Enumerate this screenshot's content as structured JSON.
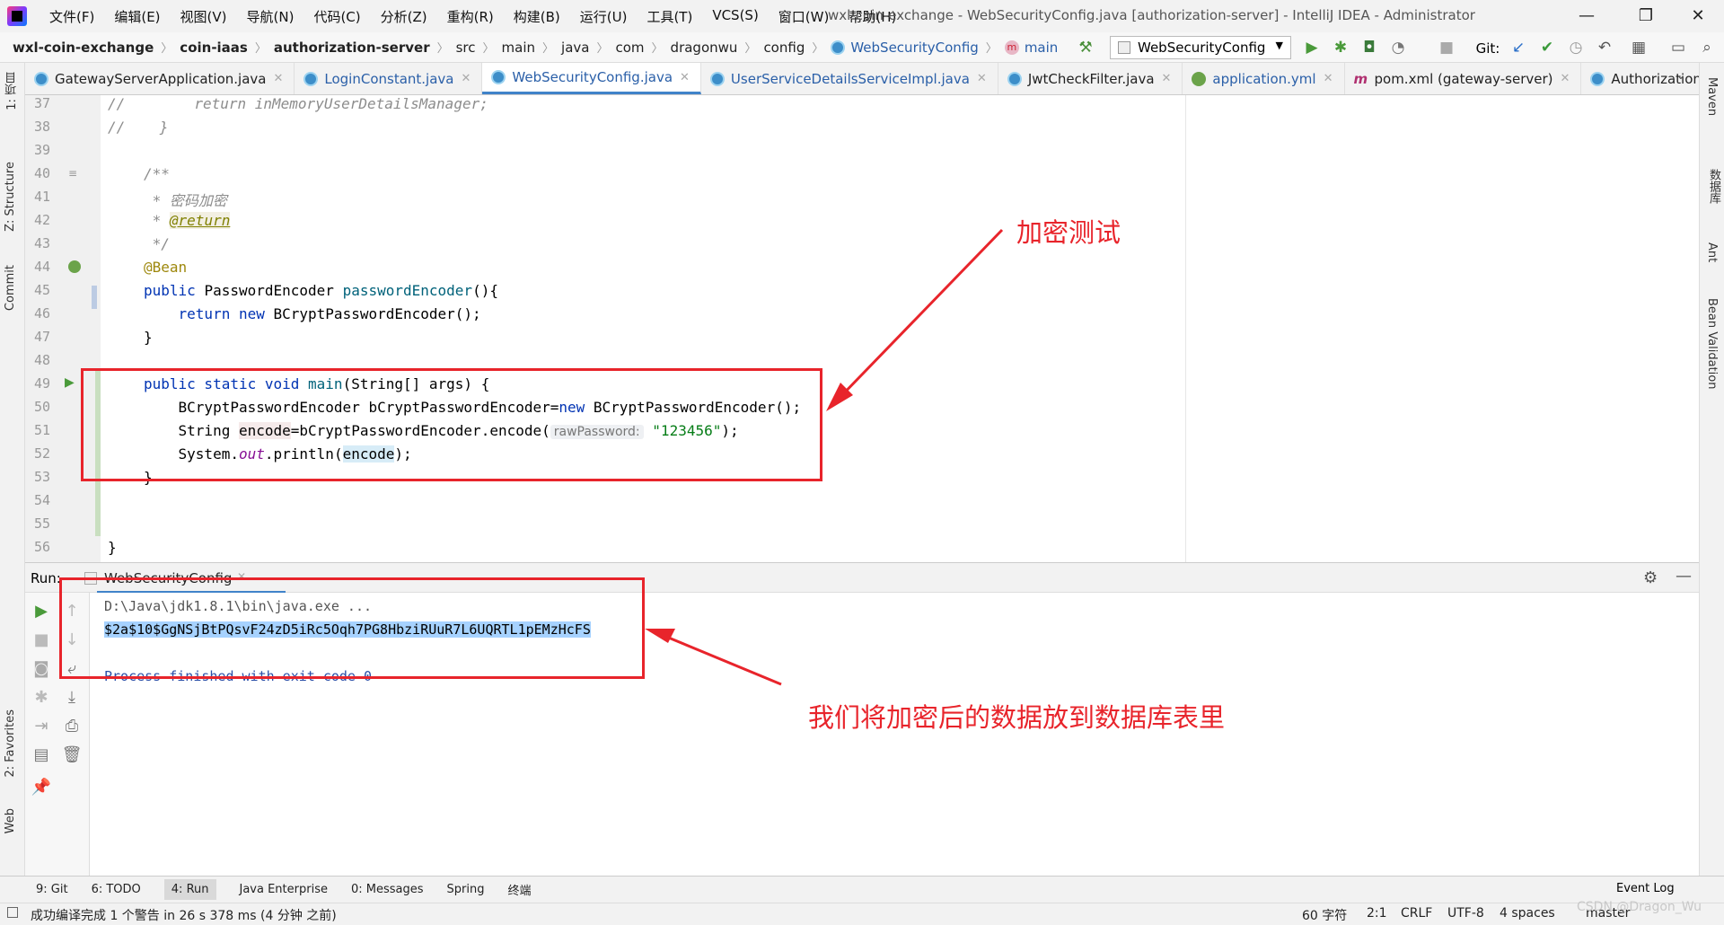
{
  "titlebar": {
    "menus": [
      "文件(F)",
      "编辑(E)",
      "视图(V)",
      "导航(N)",
      "代码(C)",
      "分析(Z)",
      "重构(R)",
      "构建(B)",
      "运行(U)",
      "工具(T)",
      "VCS(S)",
      "窗口(W)",
      "帮助(H)"
    ],
    "window_title": "wxl-coin-exchange - WebSecurityConfig.java [authorization-server] - IntelliJ IDEA - Administrator",
    "minimize": "—",
    "restore": "❐",
    "close": "✕"
  },
  "navbar": {
    "crumbs": [
      "wxl-coin-exchange",
      "coin-iaas",
      "authorization-server",
      "src",
      "main",
      "java",
      "com",
      "dragonwu",
      "config",
      "WebSecurityConfig",
      "main"
    ],
    "run_config": "WebSecurityConfig",
    "git_label": "Git:"
  },
  "tabs": [
    {
      "label": "GatewayServerApplication.java",
      "icon": "class-icon"
    },
    {
      "label": "LoginConstant.java",
      "icon": "class-icon"
    },
    {
      "label": "WebSecurityConfig.java",
      "icon": "class-icon",
      "active": true
    },
    {
      "label": "UserServiceDetailsServiceImpl.java",
      "icon": "class-icon"
    },
    {
      "label": "JwtCheckFilter.java",
      "icon": "class-icon"
    },
    {
      "label": "application.yml",
      "icon": "yaml-icon"
    },
    {
      "label": "pom.xml (gateway-server)",
      "icon": "maven-icon"
    },
    {
      "label": "AuthorizationAp",
      "icon": "class-icon"
    }
  ],
  "left_strip": [
    "1: 项目",
    "Z: Structure",
    "Commit",
    "2: Favorites",
    "Web"
  ],
  "right_strip": [
    "Maven",
    "数据库",
    "Ant",
    "Bean Validation"
  ],
  "editor": {
    "line_numbers": [
      "37",
      "38",
      "39",
      "40",
      "41",
      "42",
      "43",
      "44",
      "45",
      "46",
      "47",
      "48",
      "49",
      "50",
      "51",
      "52",
      "53",
      "54",
      "55",
      "56"
    ],
    "lines": {
      "l37a": "//",
      "l37b": "        return inMemoryUserDetailsManager;",
      "l38a": "//",
      "l38b": "    }",
      "l40": "/**",
      "l41": " * 密码加密",
      "l42a": " * ",
      "l42b": "@return",
      "l43": " */",
      "l44": "@Bean",
      "l45a": "public ",
      "l45b": "PasswordEncoder ",
      "l45c": "passwordEncoder",
      "l45d": "(){",
      "l46a": "    return new ",
      "l46b": "BCryptPasswordEncoder();",
      "l47": "}",
      "l49a": "public static void ",
      "l49b": "main",
      "l49c": "(String[] args) {",
      "l50a": "    BCryptPasswordEncoder bCryptPasswordEncoder=",
      "l50b": "new ",
      "l50c": "BCryptPasswordEncoder();",
      "l51a": "    String ",
      "l51b": "encode",
      "l51c": "=bCryptPasswordEncoder.encode(",
      "l51hint": "rawPassword:",
      "l51d": "\"123456\"",
      "l51e": ");",
      "l52a": "    System.",
      "l52b": "out",
      "l52c": ".println(",
      "l52d": "encode",
      "l52e": ");",
      "l53": "}",
      "l56": "}"
    }
  },
  "run_panel": {
    "label": "Run:",
    "tab": "WebSecurityConfig",
    "console": {
      "cmd": "D:\\Java\\jdk1.8.1\\bin\\java.exe ...",
      "hash": "$2a$10$GgNSjBtPQsvF24zD5iRc5Oqh7PG8HbziRUuR7L6UQRTL1pEMzHcFS",
      "exit": "Process finished with exit code 0"
    }
  },
  "bottom_tabs": [
    "9: Git",
    "6: TODO",
    "4: Run",
    "Java Enterprise",
    "0: Messages",
    "Spring",
    "终端",
    "Event Log"
  ],
  "status": {
    "message": "成功编译完成 1 个警告 in 26 s 378 ms (4 分钟 之前)",
    "chars": "60 字符",
    "position": "2:1",
    "line_sep": "CRLF",
    "encoding": "UTF-8",
    "indent": "4 spaces",
    "branch": "master"
  },
  "annotations": {
    "top_note": "加密测试",
    "bottom_note": "我们将加密后的数据放到数据库表里",
    "watermark": "CSDN @Dragon_Wu",
    "color": "#e8242b"
  }
}
